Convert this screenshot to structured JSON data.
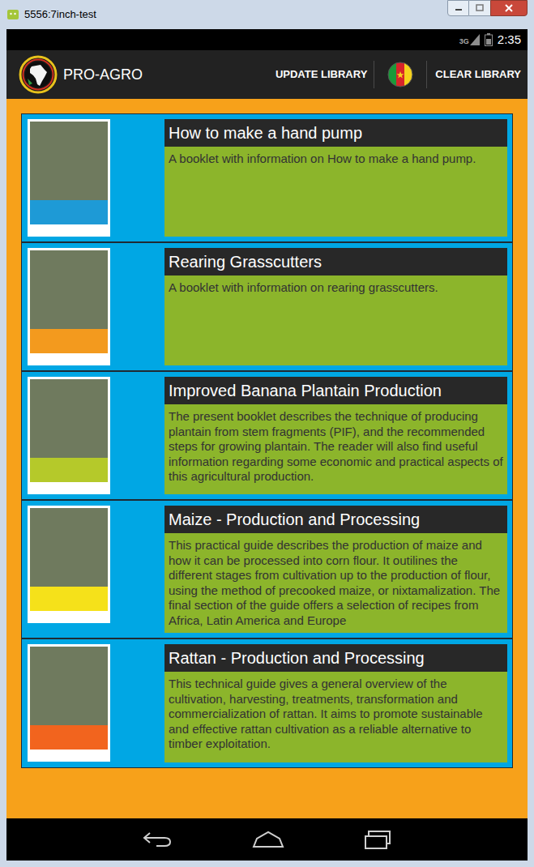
{
  "window": {
    "title": "5556:7inch-test"
  },
  "status_bar": {
    "network": "3G",
    "time": "2:35"
  },
  "action_bar": {
    "app_name": "PRO-AGRO",
    "actions": [
      "UPDATE LIBRARY",
      "CLEAR LIBRARY"
    ]
  },
  "library": [
    {
      "title": "How to make a hand pump",
      "description": "A booklet with information on How to make a hand pump.",
      "color": "#1e9ad6"
    },
    {
      "title": "Rearing Grasscutters",
      "description": "A booklet with information on rearing grasscutters.",
      "color": "#f39a1e"
    },
    {
      "title": "Improved Banana Plantain Production",
      "description": "The present booklet describes the technique of producing plantain from stem fragments (PIF), and the recommended steps for growing plantain. The reader will also find useful information regarding some economic and practical aspects of this agricultural production.",
      "color": "#b5c92a"
    },
    {
      "title": "Maize - Production and Processing",
      "description": "This practical guide describes the production of maize and how it can be processed into corn flour. It outilines the different stages from cultivation up to the production of flour, using the method of precooked maize, or nixtamalization. The final section of the guide offers a selection of recipes from Africa, Latin America and Europe",
      "color": "#f5e11a"
    },
    {
      "title": "Rattan - Production and Processing",
      "description": "This technical guide gives a general overview of the cultivation, harvesting, treatments, transformation and commercialization of rattan. It aims to promote sustainable and effective rattan cultivation as a reliable alternative to timber exploitation.",
      "color": "#f2641e"
    }
  ]
}
